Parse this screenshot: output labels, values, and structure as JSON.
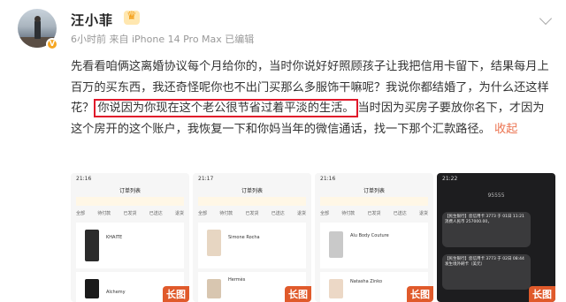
{
  "post": {
    "username": "汪小菲",
    "meta": "6小时前  来自 iPhone 14 Pro Max  已编辑",
    "text_before": "先看看咱俩这离婚协议每个月给你的，当时你说好好照顾孩子让我把信用卡留下，结果每月上百万的买东西，我还奇怪呢你也不出门买那么多服饰干嘛呢？我说你都结婚了，为什么还这样花？",
    "text_highlight": "你说因为你现在这个老公很节省过着平淡的生活。",
    "text_after": "当时因为买房子要放你名下，才因为这个房开的这个账户，我恢复一下和你妈当年的微信通话，找一下那个汇款路径。",
    "collapse_label": "收起"
  },
  "thumbnails": [
    {
      "time": "21:16",
      "title": "订单列表",
      "tabs": [
        "全部",
        "待付款",
        "已发货",
        "已送达",
        "退货"
      ],
      "items": [
        "KHAITE",
        "Alchemy"
      ],
      "badge": "长图"
    },
    {
      "time": "21:17",
      "title": "订单列表",
      "tabs": [
        "全部",
        "待付款",
        "已发货",
        "已送达",
        "退货"
      ],
      "items": [
        "Simone Rocha",
        "Hermès"
      ],
      "badge": "长图"
    },
    {
      "time": "21:16",
      "title": "订单列表",
      "tabs": [
        "全部",
        "待付款",
        "已发货",
        "已送达",
        "退货"
      ],
      "items": [
        "Alu Body Couture",
        "Natasha Zinko"
      ],
      "badge": "长图"
    },
    {
      "time": "21:22",
      "sender": "95555",
      "messages": [
        "【民生银行】您信用卡 3773 于 01日 11:21消费人民币 257000.00，",
        "【民生银行】您信用卡 3773 于 02日 08:44发生境外刷卡（美元）"
      ],
      "badge": "长图"
    }
  ],
  "colors": {
    "highlight_border": "#e0182a",
    "collapse_link": "#eb7350",
    "badge_bg": "#e05a2b"
  }
}
